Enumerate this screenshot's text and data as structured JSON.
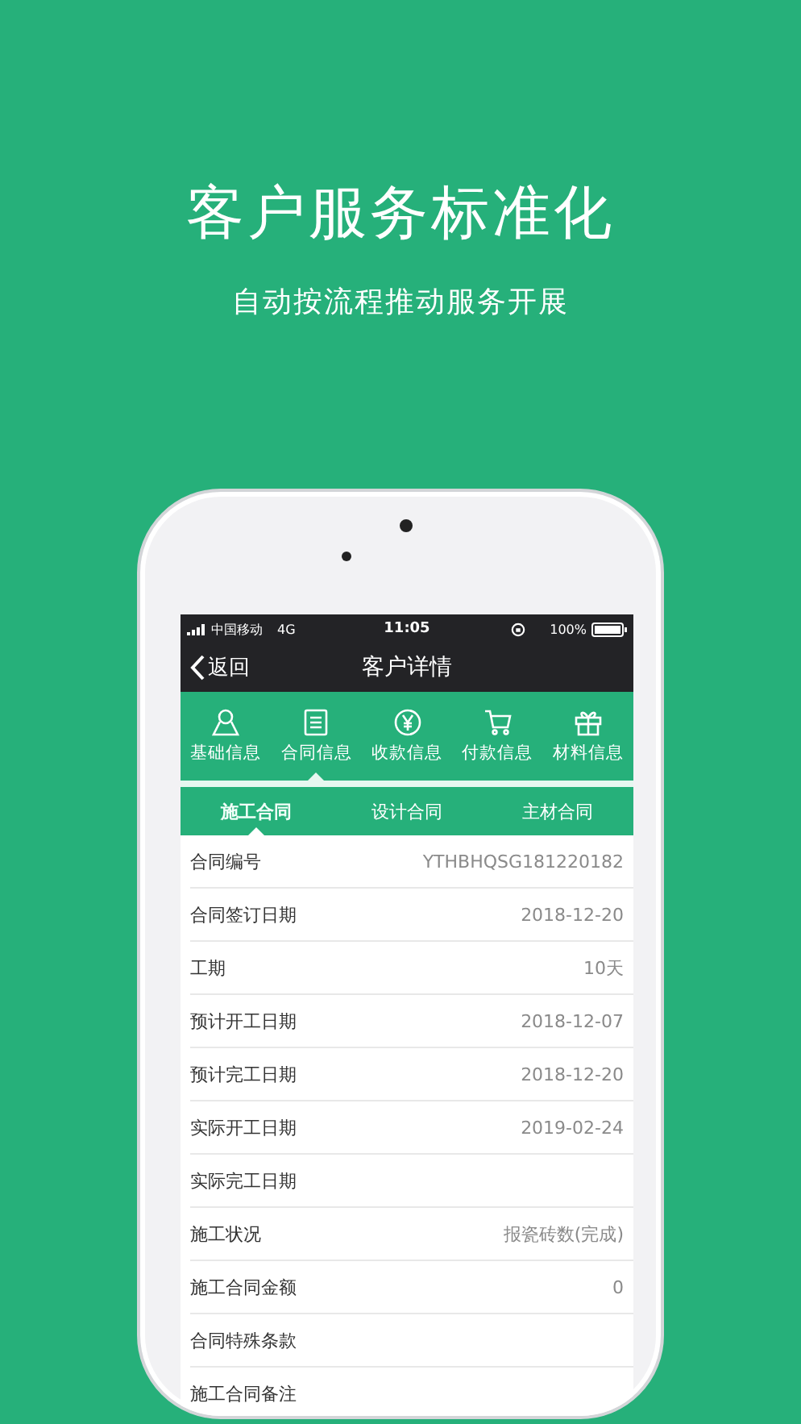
{
  "promo": {
    "title": "客户服务标准化",
    "subtitle": "自动按流程推动服务开展"
  },
  "status_bar": {
    "carrier": "中国移动",
    "network": "4G",
    "time": "11:05",
    "battery": "100%"
  },
  "nav": {
    "back": "返回",
    "title": "客户详情"
  },
  "tabs": [
    {
      "label": "基础信息",
      "selected": false
    },
    {
      "label": "合同信息",
      "selected": true
    },
    {
      "label": "收款信息",
      "selected": false
    },
    {
      "label": "付款信息",
      "selected": false
    },
    {
      "label": "材料信息",
      "selected": false
    }
  ],
  "subtabs": [
    {
      "label": "施工合同",
      "selected": true
    },
    {
      "label": "设计合同",
      "selected": false
    },
    {
      "label": "主材合同",
      "selected": false
    }
  ],
  "fields": [
    {
      "label": "合同编号",
      "value": "YTHBHQSG181220182"
    },
    {
      "label": "合同签订日期",
      "value": "2018-12-20"
    },
    {
      "label": "工期",
      "value": "10天"
    },
    {
      "label": "预计开工日期",
      "value": "2018-12-07"
    },
    {
      "label": "预计完工日期",
      "value": "2018-12-20"
    },
    {
      "label": "实际开工日期",
      "value": "2019-02-24"
    },
    {
      "label": "实际完工日期"
    },
    {
      "label": "施工状况",
      "value": "报瓷砖数(完成)"
    },
    {
      "label": "施工合同金额",
      "value": "0"
    },
    {
      "label": "合同特殊条款"
    },
    {
      "label": "施工合同备注"
    }
  ]
}
